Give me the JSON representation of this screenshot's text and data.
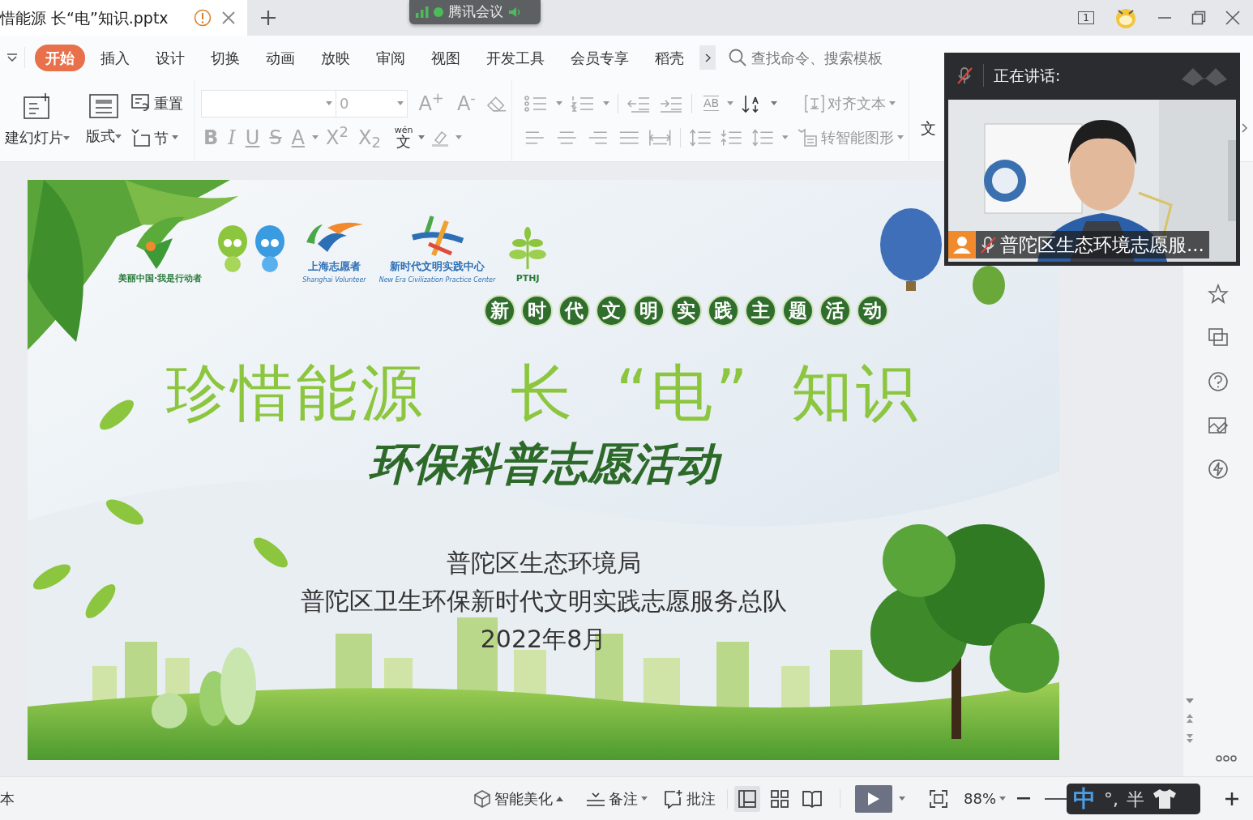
{
  "window": {
    "tab_title": "惜能源 长“电”知识.pptx",
    "screen_count": "1"
  },
  "meeting": {
    "app_title": "腾讯会议"
  },
  "ribbon_tabs": [
    {
      "label": "开始",
      "selected": true
    },
    {
      "label": "插入",
      "selected": false
    },
    {
      "label": "设计",
      "selected": false
    },
    {
      "label": "切换",
      "selected": false
    },
    {
      "label": "动画",
      "selected": false
    },
    {
      "label": "放映",
      "selected": false
    },
    {
      "label": "审阅",
      "selected": false
    },
    {
      "label": "视图",
      "selected": false
    },
    {
      "label": "开发工具",
      "selected": false
    },
    {
      "label": "会员专享",
      "selected": false
    },
    {
      "label": "稻壳",
      "selected": false
    }
  ],
  "search": {
    "placeholder": "查找命令、搜索模板"
  },
  "toolbar": {
    "new_slide": "建幻灯片",
    "layout": "版式",
    "reset": "重置",
    "section": "节",
    "font_size": "0",
    "grow_font": "A$^{+}$",
    "shrink_font": "A$^{-}$",
    "format_chars": [
      "B",
      "I",
      "U",
      "S",
      "A",
      "X$^{2}$",
      "X$_{2}$"
    ],
    "pinyin": "wén",
    "pinyin_char": "文",
    "text_box": "AB",
    "align_text": "对齐文本",
    "smart_shape": "转智能图形",
    "text_cut": "文"
  },
  "video": {
    "speaking_label": "正在讲话:",
    "muted": true,
    "participant": "普陀区生态环境志愿服...",
    "participant_muted": true
  },
  "slide": {
    "logos": [
      {
        "caption": "美丽中国·我是行动者"
      },
      {
        "caption": "上海志愿者",
        "subcaption": "Shanghai Volunteer"
      },
      {
        "caption": "新时代文明实践中心",
        "subcaption": "New Era Civilization Practice Center"
      },
      {
        "caption": "PTHJ"
      }
    ],
    "banner": "新时代文明实践主题活动",
    "title_parts": [
      "珍惜能源",
      "长",
      "“电”",
      "知识"
    ],
    "subtitle": "环保科普志愿活动",
    "lines": [
      "普陀区生态环境局",
      "普陀区卫生环保新时代文明实践志愿服务总队",
      "2022年8月"
    ]
  },
  "status": {
    "left_text": "本",
    "beautify": "智能美化",
    "notes": "备注",
    "comments": "批注",
    "views": [
      {
        "kind": "normal",
        "selected": true
      },
      {
        "kind": "sorter",
        "selected": false
      },
      {
        "kind": "reading",
        "selected": false
      }
    ],
    "zoom": "88%",
    "ime": {
      "mode": "中",
      "punct": "°,",
      "width": "半"
    }
  }
}
